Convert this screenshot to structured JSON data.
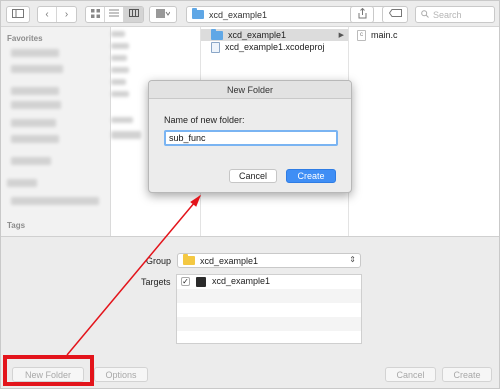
{
  "toolbar": {
    "path_label": "xcd_example1",
    "search_placeholder": "Search"
  },
  "sidebar": {
    "favorites_header": "Favorites",
    "tags_header": "Tags"
  },
  "browser": {
    "col2_items": [
      {
        "label": "xcd_example1",
        "type": "folder",
        "selected": true
      },
      {
        "label": "xcd_example1.xcodeproj",
        "type": "document",
        "selected": false
      }
    ],
    "col3_items": [
      {
        "label": "main.c",
        "type": "c-file"
      }
    ]
  },
  "dialog": {
    "title": "New Folder",
    "prompt": "Name of new folder:",
    "input_value": "sub_func",
    "cancel_label": "Cancel",
    "create_label": "Create"
  },
  "options_panel": {
    "group_label": "Group",
    "group_value": "xcd_example1",
    "targets_label": "Targets",
    "targets": [
      {
        "label": "xcd_example1",
        "checked": true,
        "check_glyph": "✓"
      }
    ]
  },
  "footer": {
    "new_folder_label": "New Folder",
    "options_label": "Options",
    "cancel_label": "Cancel",
    "create_label": "Create"
  },
  "colors": {
    "annotation": "#e3141b",
    "accent": "#3f8ef5",
    "folder_blue": "#5fa7e6",
    "folder_yellow": "#f4c842"
  }
}
